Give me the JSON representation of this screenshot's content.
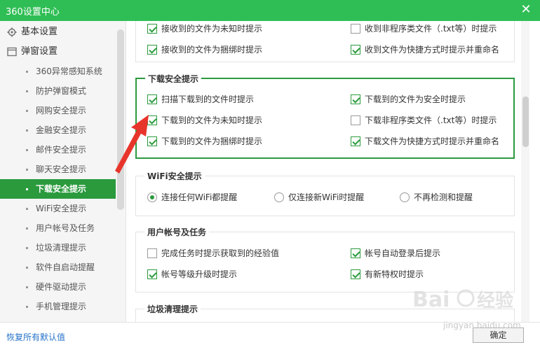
{
  "window": {
    "title": "360设置中心",
    "close_glyph": "✕"
  },
  "sidebar": {
    "sections": [
      {
        "label": "基本设置",
        "icon": "gear-icon"
      },
      {
        "label": "弹窗设置",
        "icon": "window-icon"
      }
    ],
    "items": [
      {
        "label": "360异常感知系统",
        "active": false
      },
      {
        "label": "防护弹窗模式",
        "active": false
      },
      {
        "label": "网购安全提示",
        "active": false
      },
      {
        "label": "金融安全提示",
        "active": false
      },
      {
        "label": "邮件安全提示",
        "active": false
      },
      {
        "label": "聊天安全提示",
        "active": false
      },
      {
        "label": "下载安全提示",
        "active": true
      },
      {
        "label": "WiFi安全提示",
        "active": false
      },
      {
        "label": "用户帐号及任务",
        "active": false
      },
      {
        "label": "垃圾清理提示",
        "active": false
      },
      {
        "label": "软件自启动提醒",
        "active": false
      },
      {
        "label": "硬件驱动提示",
        "active": false
      },
      {
        "label": "手机管理提示",
        "active": false
      }
    ]
  },
  "content": {
    "partial_box": {
      "options": [
        {
          "label": "接收到的文件为未知时提示",
          "checked": true
        },
        {
          "label": "收到非程序类文件（.txt等）时提示",
          "checked": false
        },
        {
          "label": "接收到的文件为捆绑时提示",
          "checked": true
        },
        {
          "label": "收到文件为快捷方式时提示并重命名",
          "checked": true
        }
      ]
    },
    "download_box": {
      "title": "下载安全提示",
      "options": [
        {
          "label": "扫描下载到的文件时提示",
          "checked": true
        },
        {
          "label": "下载到的文件为安全时提示",
          "checked": true
        },
        {
          "label": "下载到的文件为未知时提示",
          "checked": true
        },
        {
          "label": "下载非程序类文件（.txt等）时提示",
          "checked": false
        },
        {
          "label": "下载到的文件为捆绑时提示",
          "checked": true
        },
        {
          "label": "下载文件为快捷方式时提示并重命名",
          "checked": true
        }
      ]
    },
    "wifi_box": {
      "title": "WiFi安全提示",
      "options": [
        {
          "label": "连接任何WiFi都提醒",
          "checked": true
        },
        {
          "label": "仅连接新WiFi时提醒",
          "checked": false
        },
        {
          "label": "不再检测和提醒",
          "checked": false
        }
      ]
    },
    "account_box": {
      "title": "用户帐号及任务",
      "options": [
        {
          "label": "完成任务时提示获取到的经验值",
          "checked": false
        },
        {
          "label": "帐号自动登录后提示",
          "checked": true
        },
        {
          "label": "帐号等级升级时提示",
          "checked": true
        },
        {
          "label": "有新特权时提示",
          "checked": true
        }
      ]
    },
    "trash_box": {
      "title": "垃圾清理提示"
    }
  },
  "footer": {
    "reset_label": "恢复所有默认值",
    "ok_label": "确定"
  },
  "colors": {
    "accent": "#2fbe55",
    "active": "#2b9a3d",
    "link": "#2673c9",
    "annotation_arrow": "#e8352c"
  },
  "watermark": {
    "text": "jingyan.baidu.com"
  }
}
